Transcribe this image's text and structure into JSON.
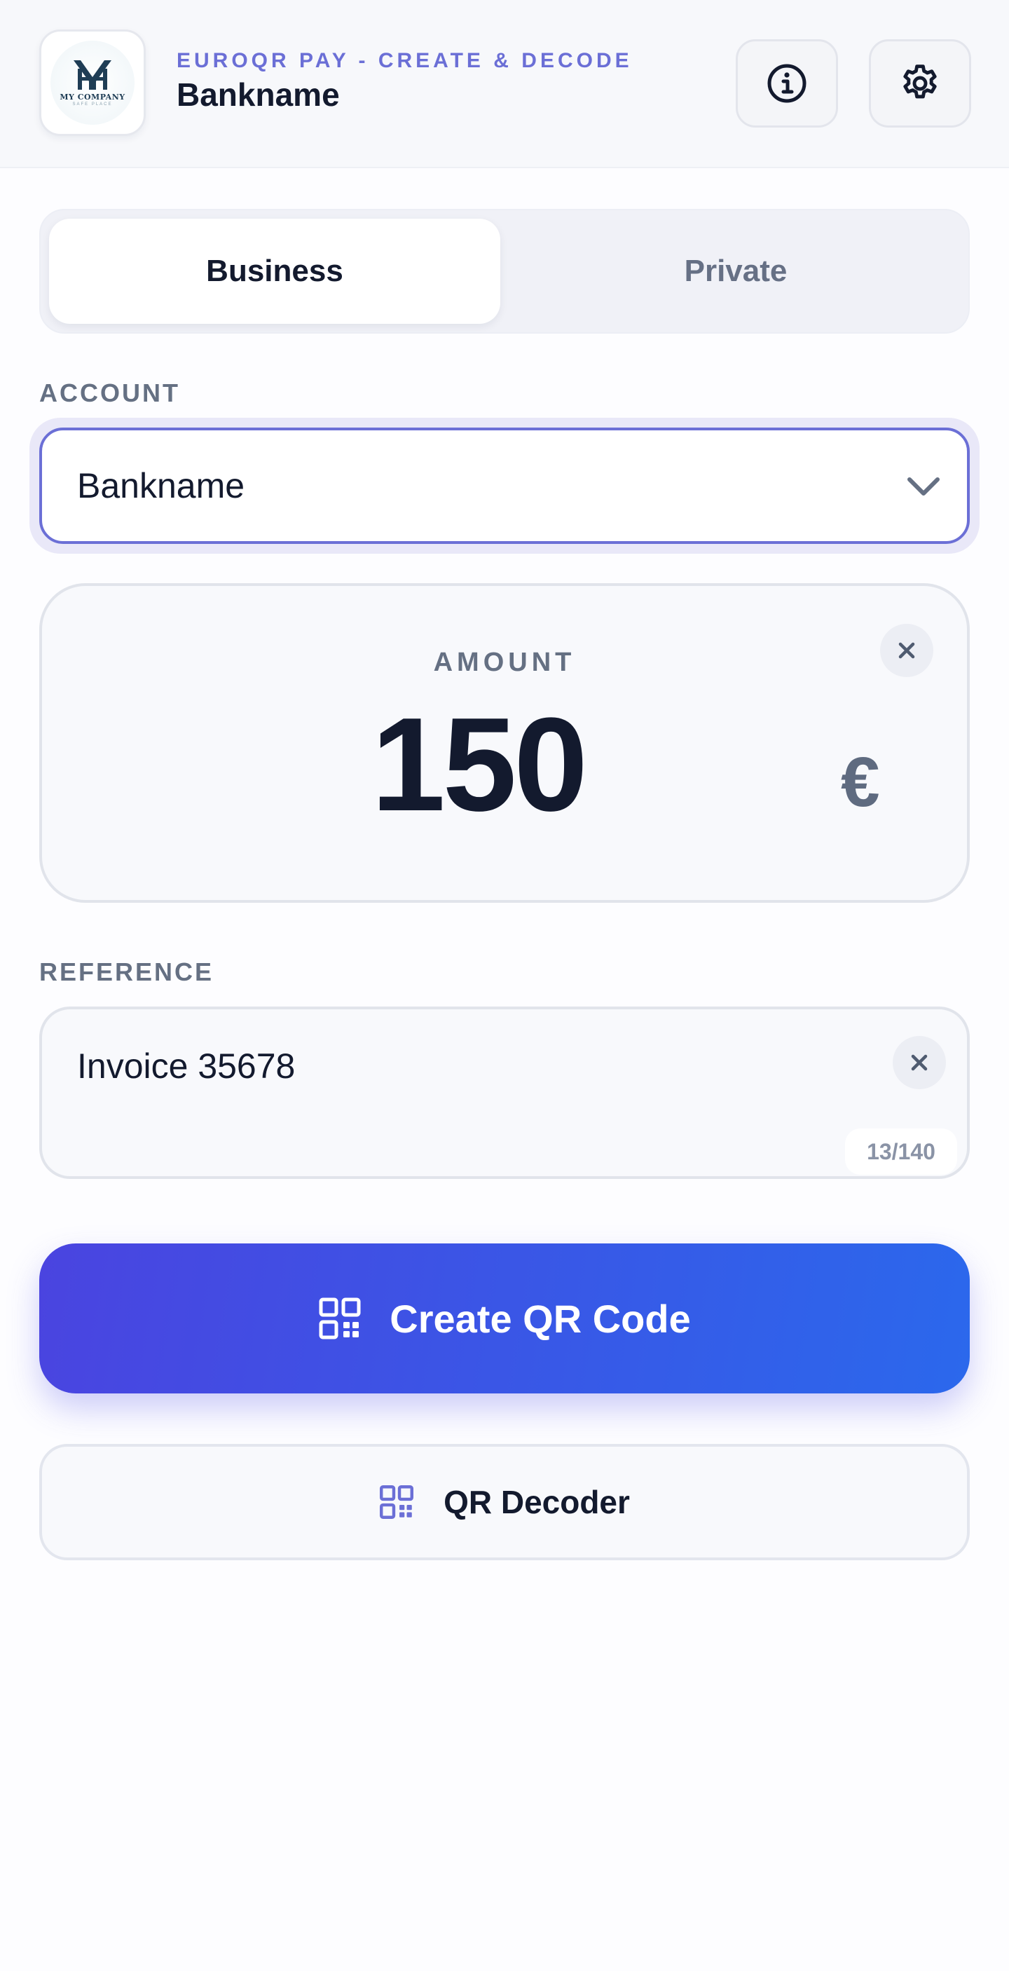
{
  "header": {
    "subtitle": "EUROQR PAY - CREATE & DECODE",
    "title": "Bankname",
    "logo": {
      "text": "MY COMPANY",
      "tagline": "SAFE PLACE"
    },
    "info_icon": "info-icon",
    "settings_icon": "gear-icon"
  },
  "mode_tabs": [
    {
      "label": "Business",
      "selected": true
    },
    {
      "label": "Private",
      "selected": false
    }
  ],
  "account": {
    "label": "ACCOUNT",
    "selected_value": "Bankname"
  },
  "amount": {
    "label": "AMOUNT",
    "value": "150",
    "currency": "€"
  },
  "reference": {
    "label": "REFERENCE",
    "value": "Invoice 35678",
    "char_count": "13/140"
  },
  "buttons": {
    "create_qr": "Create QR Code",
    "qr_decoder": "QR Decoder"
  },
  "colors": {
    "accent": "#6b6fd6",
    "primary_gradient_start": "#4a44e0",
    "primary_gradient_end": "#2b68ec",
    "text_dark": "#131a2e",
    "text_muted": "#657083"
  }
}
